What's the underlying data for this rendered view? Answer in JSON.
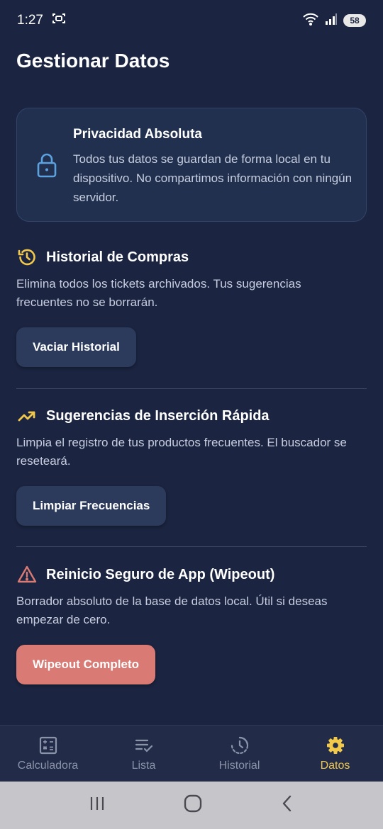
{
  "status_bar": {
    "time": "1:27",
    "battery": "58"
  },
  "page": {
    "title": "Gestionar Datos"
  },
  "privacy": {
    "title": "Privacidad Absoluta",
    "text": "Todos tus datos se guardan de forma local en tu dispositivo. No compartimos información con ningún servidor."
  },
  "sections": [
    {
      "title": "Historial de Compras",
      "description": "Elimina todos los tickets archivados. Tus sugerencias frecuentes no se borrarán.",
      "button": "Vaciar Historial",
      "icon": "history-icon"
    },
    {
      "title": "Sugerencias de Inserción Rápida",
      "description": "Limpia el registro de tus productos frecuentes. El buscador se reseteará.",
      "button": "Limpiar Frecuencias",
      "icon": "trending-up-icon"
    },
    {
      "title": "Reinicio Seguro de App (Wipeout)",
      "description": "Borrador absoluto de la base de datos local. Útil si deseas empezar de cero.",
      "button": "Wipeout Completo",
      "icon": "warning-icon"
    }
  ],
  "bottom_nav": [
    {
      "label": "Calculadora",
      "icon": "calculator-icon"
    },
    {
      "label": "Lista",
      "icon": "checklist-icon"
    },
    {
      "label": "Historial",
      "icon": "history-icon"
    },
    {
      "label": "Datos",
      "icon": "gear-icon",
      "active": true
    }
  ],
  "colors": {
    "background": "#1b2440",
    "accent": "#f2c84b",
    "danger": "#d97a74",
    "card": "#22304f",
    "lock_icon": "#5aa2e0"
  }
}
